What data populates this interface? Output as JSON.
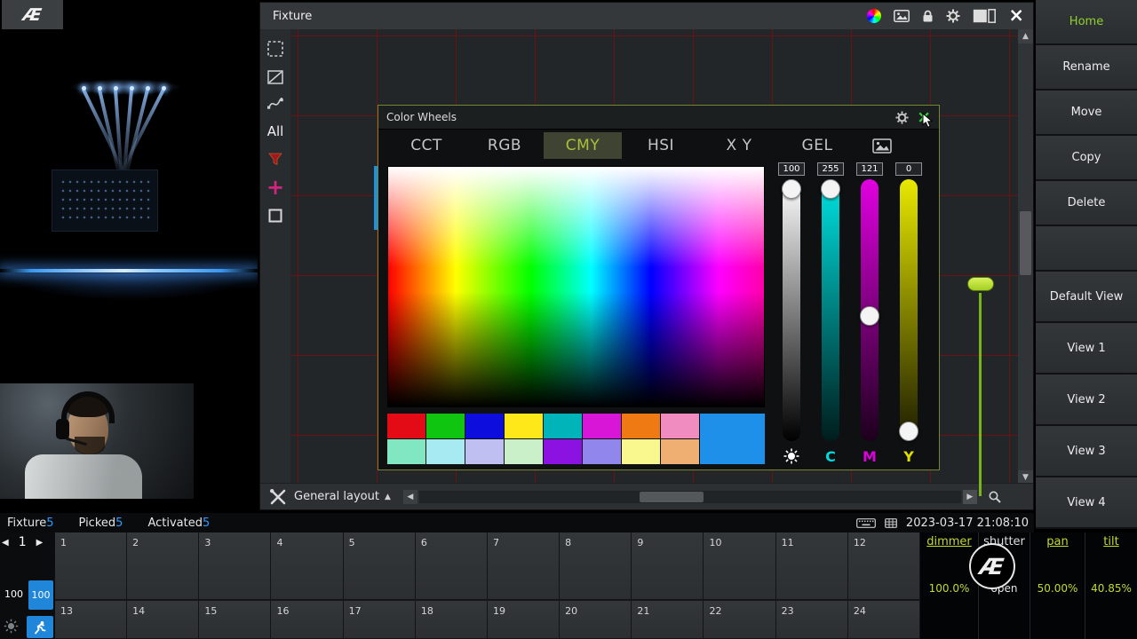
{
  "app": {
    "brand": "Æ"
  },
  "icons": {
    "close": "×",
    "caret_up": "▲",
    "scroll_up": "▲",
    "scroll_down": "▼",
    "nav_left": "◀",
    "nav_right": "▶",
    "page_prev": "◀",
    "page_next": "▶",
    "plus": "+"
  },
  "accent": {
    "green": "#9fc92e",
    "blue": "#2f9bff"
  },
  "window": {
    "title": "Fixture",
    "toolbar": {
      "all_label": "All"
    },
    "footer": {
      "layout_label": "General layout"
    }
  },
  "dialog": {
    "title": "Color Wheels",
    "tabs": [
      {
        "label": "CCT",
        "active": false
      },
      {
        "label": "RGB",
        "active": false
      },
      {
        "label": "CMY",
        "active": true
      },
      {
        "label": "HSI",
        "active": false
      },
      {
        "label": "X Y",
        "active": false
      },
      {
        "label": "GEL",
        "active": false
      }
    ],
    "sliders": [
      {
        "name": "brightness",
        "label": "",
        "value": 100,
        "max": 100,
        "track_top": "#ffffff",
        "track_bottom": "#000000",
        "label_color": "#ffffff"
      },
      {
        "name": "cyan",
        "label": "C",
        "value": 255,
        "max": 255,
        "track_top": "#00e2e2",
        "track_bottom": "#001c1c",
        "label_color": "#00d9d9"
      },
      {
        "name": "magenta",
        "label": "M",
        "value": 121,
        "max": 255,
        "track_top": "#e000e0",
        "track_bottom": "#1c001c",
        "label_color": "#dc00dc"
      },
      {
        "name": "yellow",
        "label": "Y",
        "value": 0,
        "max": 255,
        "track_top": "#e8e800",
        "track_bottom": "#1c1c00",
        "label_color": "#e0e000"
      }
    ],
    "swatches_row1": [
      "#e30b16",
      "#10c510",
      "#0d0ddd",
      "#ffe81a",
      "#00b4ba",
      "#d816d8",
      "#ef7a14",
      "#f18cc0"
    ],
    "swatches_row2": [
      "#80e7c2",
      "#a8eaf2",
      "#bfbff1",
      "#c9f0c9",
      "#8c12e2",
      "#9186ec",
      "#f8f88e",
      "#efae72"
    ],
    "big_swatch": "#1f90ea"
  },
  "sidebar": {
    "items": [
      {
        "label": "Home",
        "accent": true
      },
      {
        "label": "Rename"
      },
      {
        "label": "Move"
      },
      {
        "label": "Copy"
      },
      {
        "label": "Delete"
      },
      {
        "label": ""
      },
      {
        "label": "Default View"
      },
      {
        "label": "View 1"
      },
      {
        "label": "View 2"
      },
      {
        "label": "View 3"
      },
      {
        "label": "View 4"
      }
    ]
  },
  "status_bar": {
    "entries": [
      {
        "label": "Fixture",
        "count": "5"
      },
      {
        "label": "Picked",
        "count": "5"
      },
      {
        "label": "Activated",
        "count": "5"
      }
    ],
    "timestamp": "2023-03-17 21:08:10"
  },
  "playback": {
    "page": "1",
    "fader_value": "100",
    "bank_value": "100",
    "cells_row1": [
      "1",
      "2",
      "3",
      "4",
      "5",
      "6",
      "7",
      "8",
      "9",
      "10",
      "11",
      "12"
    ],
    "cells_row2": [
      "13",
      "14",
      "15",
      "16",
      "17",
      "18",
      "19",
      "20",
      "21",
      "22",
      "23",
      "24"
    ]
  },
  "parameters": [
    {
      "label": "dimmer",
      "value": "100.0%",
      "accent": true
    },
    {
      "label": "shutter",
      "value": "open",
      "accent": false
    },
    {
      "label": "pan",
      "value": "50.00%",
      "accent": true
    },
    {
      "label": "tilt",
      "value": "40.85%",
      "accent": true
    }
  ]
}
